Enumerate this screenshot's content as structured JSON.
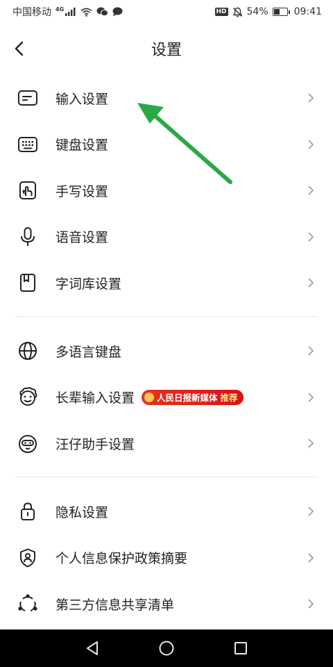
{
  "status_bar": {
    "carrier": "中国移动",
    "network": "4G",
    "battery_text": "54%",
    "battery_level": 0.54,
    "time": "09:41",
    "hd": "HD"
  },
  "header": {
    "title": "设置",
    "back_icon": "chevron-left-icon"
  },
  "groups": [
    {
      "items": [
        {
          "label": "输入设置",
          "icon": "input-settings-icon"
        },
        {
          "label": "键盘设置",
          "icon": "keyboard-icon"
        },
        {
          "label": "手写设置",
          "icon": "handwriting-icon"
        },
        {
          "label": "语音设置",
          "icon": "microphone-icon"
        },
        {
          "label": "字词库设置",
          "icon": "dictionary-icon"
        }
      ]
    },
    {
      "items": [
        {
          "label": "多语言键盘",
          "icon": "globe-icon"
        },
        {
          "label": "长辈输入设置",
          "icon": "elder-icon",
          "badge": {
            "main": "人民日报新媒体",
            "highlight": "推荐"
          }
        },
        {
          "label": "汪仔助手设置",
          "icon": "assistant-icon"
        }
      ]
    },
    {
      "items": [
        {
          "label": "隐私设置",
          "icon": "lock-icon"
        },
        {
          "label": "个人信息保护政策摘要",
          "icon": "shield-user-icon"
        },
        {
          "label": "第三方信息共享清单",
          "icon": "share-icon"
        }
      ]
    }
  ],
  "colors": {
    "annotation_arrow": "#2aa845",
    "badge": "#e0251c",
    "text": "#222222",
    "chevron": "#9a9a9a"
  },
  "nav": {
    "back": "nav-back-icon",
    "home": "nav-home-icon",
    "recents": "nav-recents-icon"
  }
}
